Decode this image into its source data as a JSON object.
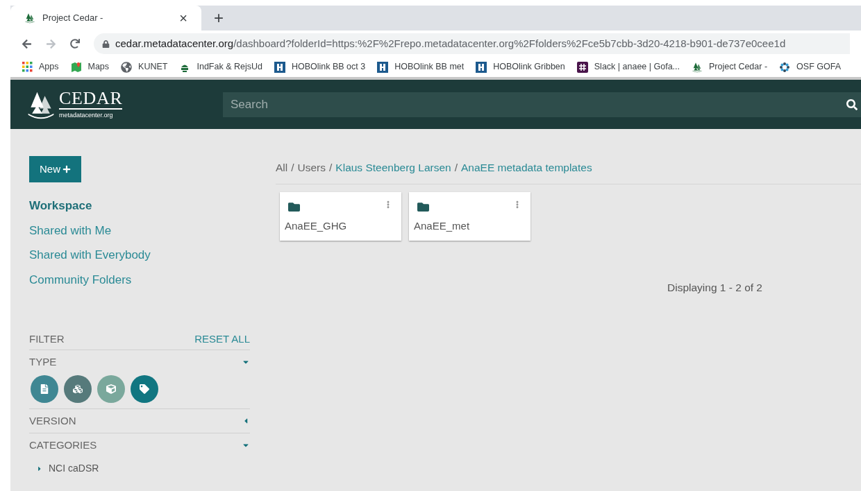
{
  "browser": {
    "tab": {
      "title": "Project Cedar -",
      "close": "×"
    },
    "new_tab": "+",
    "url": {
      "host": "cedar.metadatacenter.org",
      "path": "/dashboard?folderId=https:%2F%2Frepo.metadatacenter.org%2Ffolders%2Fce5b7cbb-3d20-4218-b901-de737e0cee1d"
    },
    "bookmarks": [
      {
        "kind": "apps",
        "label": "Apps"
      },
      {
        "kind": "map",
        "label": "Maps"
      },
      {
        "kind": "globe",
        "label": "KUNET"
      },
      {
        "kind": "emblem",
        "label": "IndFak & RejsUd"
      },
      {
        "kind": "hobo",
        "label": "HOBOlink BB oct 3"
      },
      {
        "kind": "hobo",
        "label": "HOBOlink BB met"
      },
      {
        "kind": "hobo",
        "label": "HOBOlink Gribben"
      },
      {
        "kind": "slack",
        "label": "Slack | anaee | Gofa..."
      },
      {
        "kind": "tree",
        "label": "Project Cedar -"
      },
      {
        "kind": "osf",
        "label": "OSF GOFA"
      }
    ]
  },
  "header": {
    "logo": {
      "title": "CEDAR",
      "subtitle": "metadatacenter.org"
    },
    "search": {
      "placeholder": "Search"
    }
  },
  "sidebar": {
    "new_button": "New",
    "nav": [
      {
        "label": "Workspace",
        "selected": true
      },
      {
        "label": "Shared with Me",
        "selected": false
      },
      {
        "label": "Shared with Everybody",
        "selected": false
      },
      {
        "label": "Community Folders",
        "selected": false
      }
    ],
    "filter": {
      "title": "FILTER",
      "reset": "RESET ALL",
      "sections": [
        {
          "label": "TYPE",
          "expanded": true,
          "types": [
            {
              "kind": "document",
              "color": "#3f8793"
            },
            {
              "kind": "elements",
              "color": "#567a7b"
            },
            {
              "kind": "field",
              "color": "#7aa89c"
            },
            {
              "kind": "tag",
              "color": "#117681"
            }
          ]
        },
        {
          "label": "VERSION",
          "expanded": false
        },
        {
          "label": "CATEGORIES",
          "expanded": true,
          "children": [
            {
              "label": "NCI caDSR",
              "expanded": false
            }
          ]
        }
      ]
    }
  },
  "main": {
    "breadcrumb": {
      "separator": "/",
      "items": [
        {
          "label": "All",
          "link": false
        },
        {
          "label": "Users",
          "link": false
        },
        {
          "label": "Klaus Steenberg Larsen",
          "link": true
        },
        {
          "label": "AnaEE metadata templates",
          "link": true
        }
      ]
    },
    "folders": [
      {
        "name": "AnaEE_GHG"
      },
      {
        "name": "AnaEE_met"
      }
    ],
    "count": "Displaying 1 - 2 of 2"
  }
}
